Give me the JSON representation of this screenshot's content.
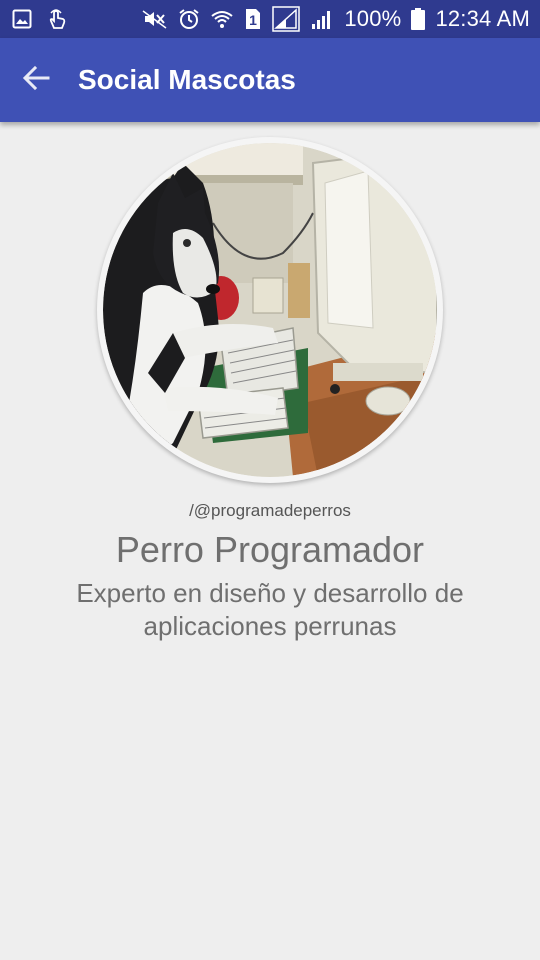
{
  "status_bar": {
    "battery_percent": "100%",
    "time": "12:34 AM",
    "sim_slot": "1",
    "icons": [
      "gallery-icon",
      "touch-icon",
      "mute-icon",
      "alarm-icon",
      "wifi-icon",
      "sim-icon",
      "signal-icon",
      "signal-icon",
      "battery-icon"
    ]
  },
  "app_bar": {
    "title": "Social Mascotas",
    "back_icon": "arrow-back-icon",
    "color": "#3f51b5"
  },
  "profile": {
    "avatar_description_icon": "avatar",
    "handle": "/@programadeperros",
    "name": "Perro Programador",
    "bio": "Experto en diseño y desarrollo de aplicaciones perrunas"
  }
}
